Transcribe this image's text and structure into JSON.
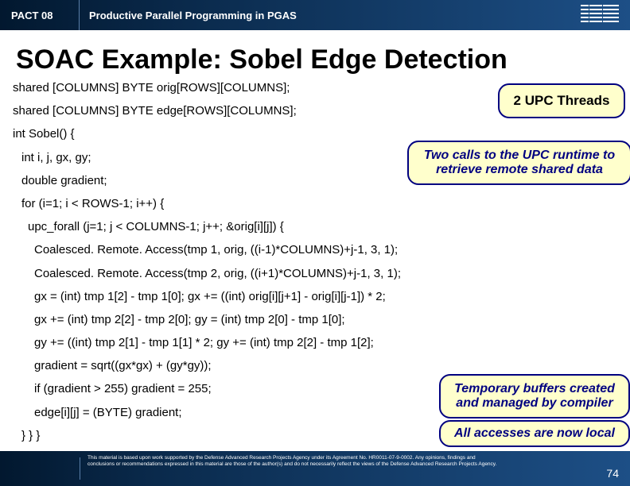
{
  "header": {
    "pact": "PACT 08",
    "course": "Productive Parallel Programming in PGAS"
  },
  "title": "SOAC Example: Sobel Edge Detection",
  "code": {
    "l1": "shared [COLUMNS] BYTE orig[ROWS][COLUMNS];",
    "l2": "shared [COLUMNS] BYTE edge[ROWS][COLUMNS];",
    "l3": "int Sobel() {",
    "l4": "int i, j, gx, gy;",
    "l5": "double gradient;",
    "l6": "for (i=1; i < ROWS-1; i++) {",
    "l7": "upc_forall (j=1; j < COLUMNS-1; j++; &orig[i][j]) {",
    "l8": "Coalesced. Remote. Access(tmp 1, orig, ((i-1)*COLUMNS)+j-1, 3, 1);",
    "l9": "Coalesced. Remote. Access(tmp 2, orig, ((i+1)*COLUMNS)+j-1, 3, 1);",
    "l10": "gx = (int) tmp 1[2] - tmp 1[0];   gx += ((int) orig[i][j+1]   - orig[i][j-1]) * 2;",
    "l11": "gx += (int) tmp 2[2] - tmp 2[0];  gy = (int) tmp 2[0] - tmp 1[0];",
    "l12": "gy += ((int) tmp 2[1] - tmp 1[1] * 2;  gy += (int) tmp 2[2] - tmp 1[2];",
    "l13": "gradient = sqrt((gx*gx) + (gy*gy));",
    "l14": "if (gradient > 255) gradient = 255;",
    "l15": "edge[i][j] = (BYTE) gradient;",
    "l16": "} } }"
  },
  "callouts": {
    "threads": "2 UPC Threads",
    "twocalls": "Two calls to the UPC runtime to retrieve remote shared data",
    "buffers": "Temporary buffers created and managed by compiler",
    "local": "All accesses are now local"
  },
  "footer": {
    "disclaimer": "This material is based upon work supported by the Defense Advanced Research Projects Agency under its Agreement No. HR0011-07-9-0002. Any opinions, findings and conclusions or recommendations expressed in this material are those of the author(s) and do not necessarily reflect the views of the Defense Advanced Research Projects Agency.",
    "page": "74"
  }
}
